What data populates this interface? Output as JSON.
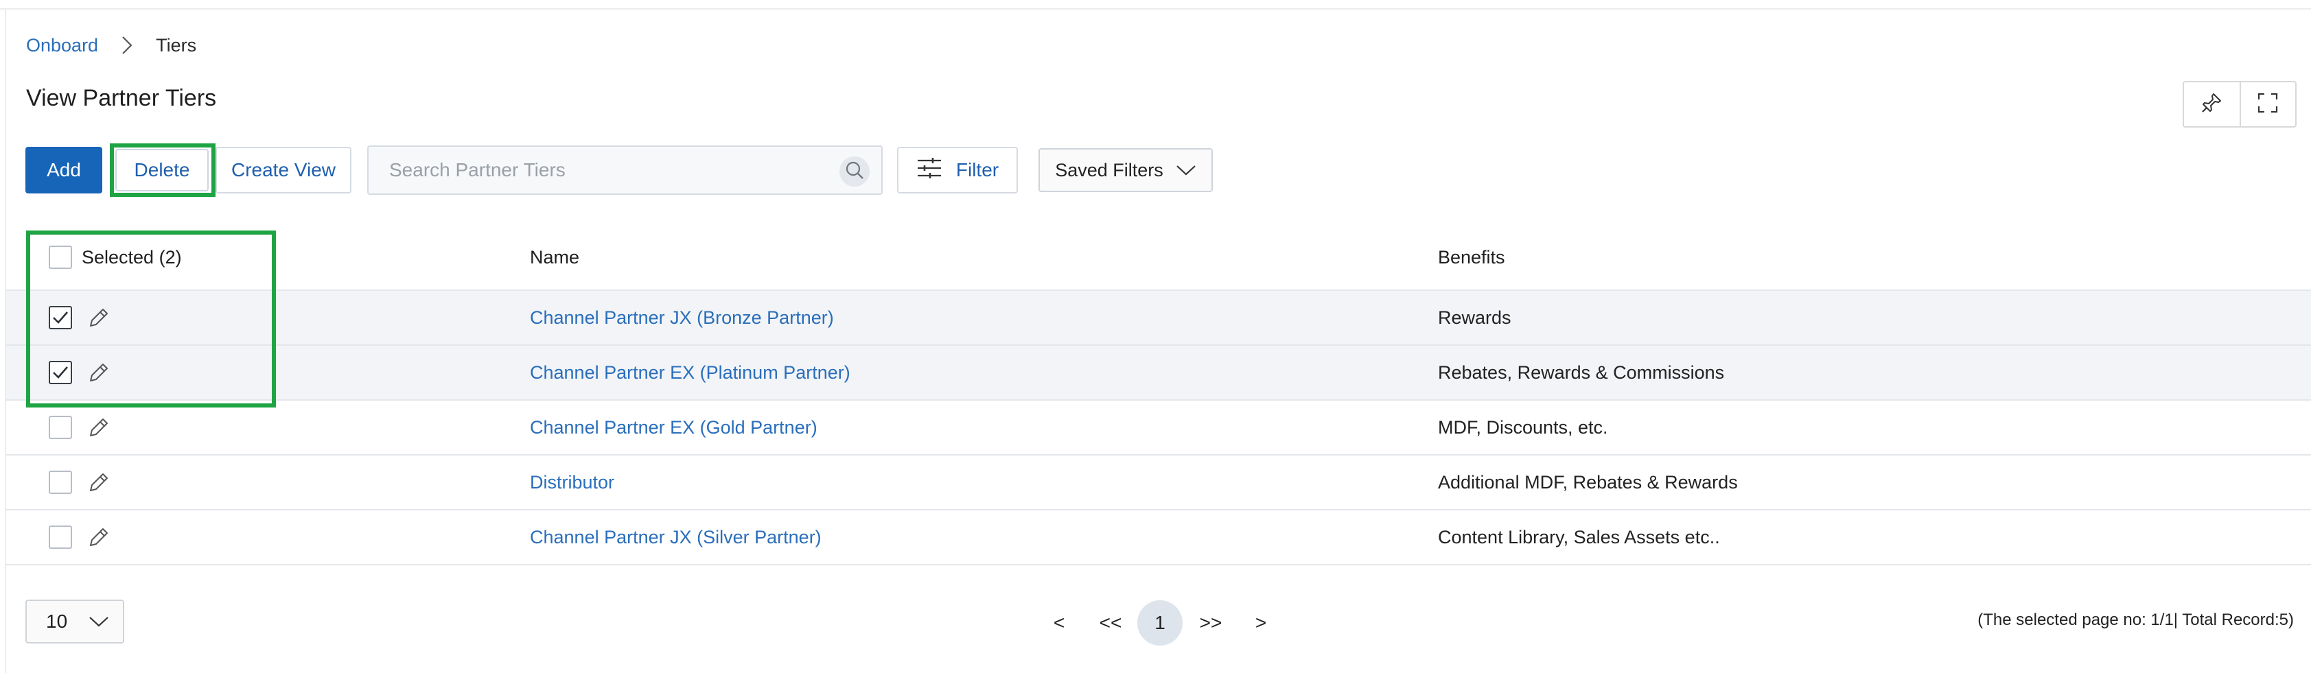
{
  "breadcrumb": {
    "parent": "Onboard",
    "current": "Tiers"
  },
  "page": {
    "title": "View Partner Tiers"
  },
  "toolbar": {
    "add_label": "Add",
    "delete_label": "Delete",
    "create_view_label": "Create View",
    "search_placeholder": "Search Partner Tiers",
    "filter_label": "Filter",
    "saved_filters_label": "Saved Filters"
  },
  "table": {
    "selected_label": "Selected (2)",
    "columns": {
      "name": "Name",
      "benefits": "Benefits"
    },
    "rows": [
      {
        "name": "Channel Partner JX (Bronze Partner)",
        "benefits": "Rewards",
        "checked": true
      },
      {
        "name": "Channel Partner EX (Platinum Partner)",
        "benefits": "Rebates, Rewards & Commissions",
        "checked": true
      },
      {
        "name": "Channel Partner EX (Gold Partner)",
        "benefits": "MDF, Discounts, etc.",
        "checked": false
      },
      {
        "name": "Distributor",
        "benefits": "Additional MDF, Rebates & Rewards",
        "checked": false
      },
      {
        "name": "Channel Partner JX (Silver Partner)",
        "benefits": "Content Library, Sales Assets etc..",
        "checked": false
      }
    ]
  },
  "pagination": {
    "page_size": "10",
    "prev": "<",
    "first": "<<",
    "current": "1",
    "last": ">>",
    "next": ">",
    "info": "(The selected page no: 1/1| Total Record:5)"
  },
  "colors": {
    "primary": "#1665b8",
    "link": "#2a6ebb",
    "highlight": "#1ea443"
  }
}
